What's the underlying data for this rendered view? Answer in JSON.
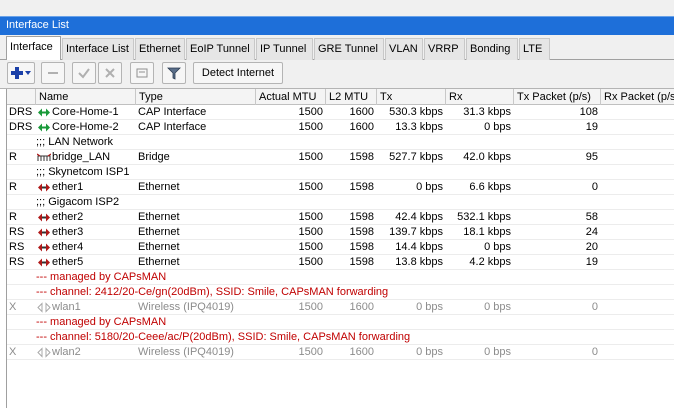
{
  "window": {
    "title": "Interface List"
  },
  "tabs": [
    "Interface",
    "Interface List",
    "Ethernet",
    "EoIP Tunnel",
    "IP Tunnel",
    "GRE Tunnel",
    "VLAN",
    "VRRP",
    "Bonding",
    "LTE"
  ],
  "toolbar": {
    "add_icon": "plus-icon",
    "detect_label": "Detect Internet"
  },
  "columns": [
    "Name",
    "Type",
    "Actual MTU",
    "L2 MTU",
    "Tx",
    "Rx",
    "Tx Packet (p/s)",
    "Rx Packet (p/s"
  ],
  "rows": [
    {
      "kind": "item",
      "flags": "DRS",
      "icon": "cap-interface-icon",
      "name": "Core-Home-1",
      "type": "CAP Interface",
      "mtu": "1500",
      "l2mtu": "1600",
      "tx": "530.3 kbps",
      "rx": "31.3 kbps",
      "txp": "108",
      "rxp": ""
    },
    {
      "kind": "item",
      "flags": "DRS",
      "icon": "cap-interface-icon",
      "name": "Core-Home-2",
      "type": "CAP Interface",
      "mtu": "1500",
      "l2mtu": "1600",
      "tx": "13.3 kbps",
      "rx": "0 bps",
      "txp": "19",
      "rxp": ""
    },
    {
      "kind": "comment",
      "text": ";;; LAN Network"
    },
    {
      "kind": "item",
      "flags": "R",
      "icon": "bridge-icon",
      "name": "bridge_LAN",
      "type": "Bridge",
      "mtu": "1500",
      "l2mtu": "1598",
      "tx": "527.7 kbps",
      "rx": "42.0 kbps",
      "txp": "95",
      "rxp": ""
    },
    {
      "kind": "comment",
      "text": ";;; Skynetcom ISP1"
    },
    {
      "kind": "item",
      "flags": "R",
      "icon": "ethernet-icon",
      "name": "ether1",
      "type": "Ethernet",
      "mtu": "1500",
      "l2mtu": "1598",
      "tx": "0 bps",
      "rx": "6.6 kbps",
      "txp": "0",
      "rxp": ""
    },
    {
      "kind": "comment",
      "text": ";;; Gigacom ISP2"
    },
    {
      "kind": "item",
      "flags": "R",
      "icon": "ethernet-icon",
      "name": "ether2",
      "type": "Ethernet",
      "mtu": "1500",
      "l2mtu": "1598",
      "tx": "42.4 kbps",
      "rx": "532.1 kbps",
      "txp": "58",
      "rxp": ""
    },
    {
      "kind": "item",
      "flags": "RS",
      "icon": "ethernet-icon",
      "name": "ether3",
      "type": "Ethernet",
      "mtu": "1500",
      "l2mtu": "1598",
      "tx": "139.7 kbps",
      "rx": "18.1 kbps",
      "txp": "24",
      "rxp": ""
    },
    {
      "kind": "item",
      "flags": "RS",
      "icon": "ethernet-icon",
      "name": "ether4",
      "type": "Ethernet",
      "mtu": "1500",
      "l2mtu": "1598",
      "tx": "14.4 kbps",
      "rx": "0 bps",
      "txp": "20",
      "rxp": ""
    },
    {
      "kind": "item",
      "flags": "RS",
      "icon": "ethernet-icon",
      "name": "ether5",
      "type": "Ethernet",
      "mtu": "1500",
      "l2mtu": "1598",
      "tx": "13.8 kbps",
      "rx": "4.2 kbps",
      "txp": "19",
      "rxp": ""
    },
    {
      "kind": "comment-red",
      "text": "--- managed by CAPsMAN"
    },
    {
      "kind": "comment-red",
      "text": "--- channel: 2412/20-Ce/gn(20dBm), SSID: Smile, CAPsMAN forwarding"
    },
    {
      "kind": "item-disabled",
      "flags": "X",
      "icon": "wireless-icon",
      "name": "wlan1",
      "type": "Wireless (IPQ4019)",
      "mtu": "1500",
      "l2mtu": "1600",
      "tx": "0 bps",
      "rx": "0 bps",
      "txp": "0",
      "rxp": ""
    },
    {
      "kind": "comment-red",
      "text": "--- managed by CAPsMAN"
    },
    {
      "kind": "comment-red",
      "text": "--- channel: 5180/20-Ceee/ac/P(20dBm), SSID: Smile, CAPsMAN forwarding"
    },
    {
      "kind": "item-disabled",
      "flags": "X",
      "icon": "wireless-icon",
      "name": "wlan2",
      "type": "Wireless (IPQ4019)",
      "mtu": "1500",
      "l2mtu": "1600",
      "tx": "0 bps",
      "rx": "0 bps",
      "txp": "0",
      "rxp": ""
    }
  ],
  "colors": {
    "title_bar": "#1e6fd9",
    "comment_red": "#c00000",
    "cap_icon": "#1a9a3a",
    "eth_icon": "#b01818"
  }
}
